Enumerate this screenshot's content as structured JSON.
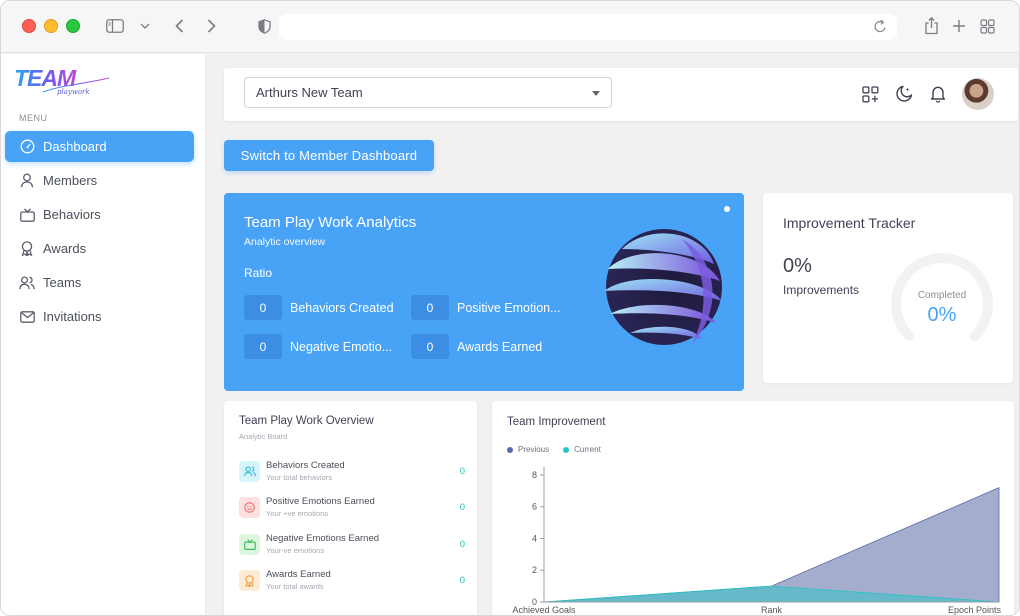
{
  "sidebar": {
    "logo_text": "TEAM",
    "logo_subtext": "playwork",
    "menu_label": "MENU",
    "items": [
      {
        "label": "Dashboard",
        "icon": "gauge-icon",
        "active": true
      },
      {
        "label": "Members",
        "icon": "person-icon",
        "active": false
      },
      {
        "label": "Behaviors",
        "icon": "tv-icon",
        "active": false
      },
      {
        "label": "Awards",
        "icon": "award-icon",
        "active": false
      },
      {
        "label": "Teams",
        "icon": "people-icon",
        "active": false
      },
      {
        "label": "Invitations",
        "icon": "envelope-icon",
        "active": false
      }
    ]
  },
  "topbar": {
    "team_select_value": "Arthurs New Team",
    "icons": [
      "apps-add-icon",
      "moon-icon",
      "bell-icon",
      "avatar"
    ]
  },
  "switch_button": "Switch to Member Dashboard",
  "analytics": {
    "title": "Team Play Work Analytics",
    "subtitle": "Analytic overview",
    "ratio_label": "Ratio",
    "stats": [
      {
        "value": "0",
        "label": "Behaviors Created"
      },
      {
        "value": "0",
        "label": "Positive Emotion..."
      },
      {
        "value": "0",
        "label": "Negative Emotio..."
      },
      {
        "value": "0",
        "label": "Awards Earned"
      }
    ]
  },
  "tracker": {
    "title": "Improvement Tracker",
    "percent": "0%",
    "label": "Improvements",
    "gauge_label": "Completed",
    "gauge_value": "0%"
  },
  "overview": {
    "title": "Team Play Work Overview",
    "subtitle": "Analytic Board",
    "rows": [
      {
        "name": "Behaviors Created",
        "sub": "Your total behaviors",
        "value": "0",
        "icon": "people-icon",
        "bg": "#d6f5fb",
        "fg": "#2cb9d8"
      },
      {
        "name": "Positive Emotions Earned",
        "sub": "Your +ve emotions",
        "value": "0",
        "icon": "smile-icon",
        "bg": "#fde0e0",
        "fg": "#f36b6b"
      },
      {
        "name": "Negative Emotions Earned",
        "sub": "Your-ve emotions",
        "value": "0",
        "icon": "tv-icon",
        "bg": "#dcf6df",
        "fg": "#3fbf5a"
      },
      {
        "name": "Awards Earned",
        "sub": "Your total awards",
        "value": "0",
        "icon": "award-icon",
        "bg": "#fdebd6",
        "fg": "#f3a04b"
      }
    ]
  },
  "improvement": {
    "title": "Team Improvement",
    "colors": {
      "previous": "#5b6aa8",
      "current": "#1cc8c0"
    }
  },
  "chart_data": {
    "type": "area",
    "categories": [
      "Achieved Goals",
      "Rank",
      "Epoch Points"
    ],
    "series": [
      {
        "name": "Previous",
        "values": [
          0,
          1,
          7.2
        ]
      },
      {
        "name": "Current",
        "values": [
          0,
          1,
          0
        ]
      }
    ],
    "yticks": [
      "0",
      "2",
      "4",
      "6",
      "8"
    ],
    "ylim": [
      0,
      8.5
    ],
    "legend": "top-left"
  }
}
